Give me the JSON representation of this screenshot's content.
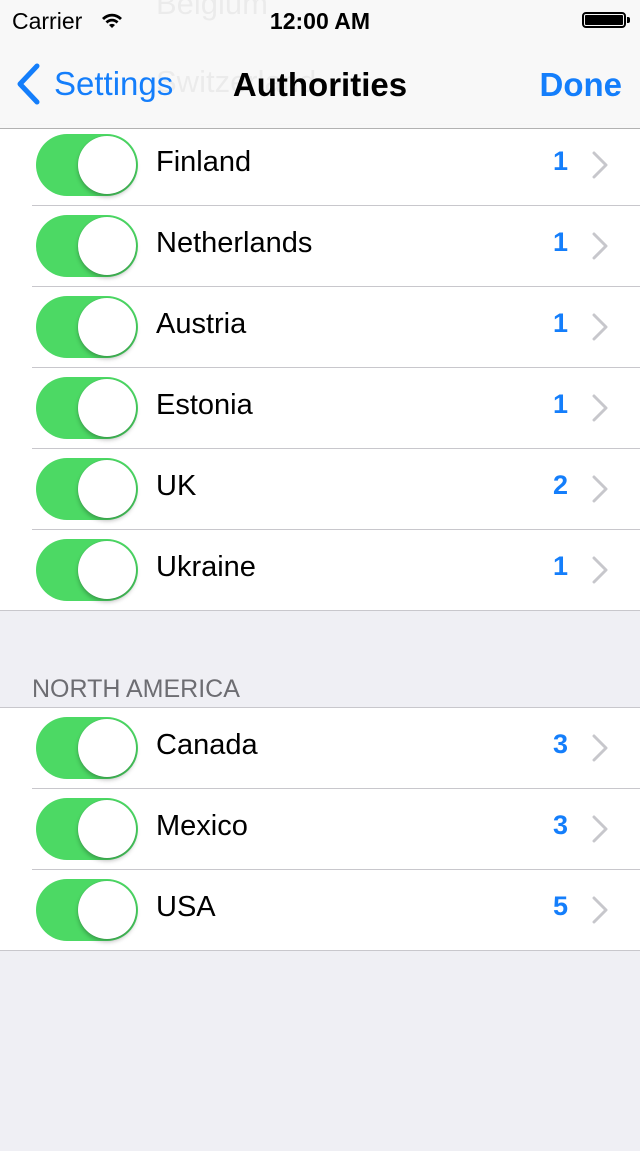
{
  "status_bar": {
    "carrier": "Carrier",
    "time": "12:00 AM",
    "wifi_icon": "wifi-icon",
    "battery_icon": "battery-icon"
  },
  "nav": {
    "back_label": "Settings",
    "back_icon": "chevron-left-icon",
    "title": "Authorities",
    "done_label": "Done",
    "ghost_rows": [
      "Belgium",
      "Switzerland"
    ]
  },
  "colors": {
    "accent": "#147efb",
    "toggle_on": "#4cd964",
    "chevron": "#c7c7cc",
    "section_header": "#6d6d72"
  },
  "sections": [
    {
      "header": "",
      "rows": [
        {
          "name": "Finland",
          "count": "1",
          "enabled": true
        },
        {
          "name": "Netherlands",
          "count": "1",
          "enabled": true
        },
        {
          "name": "Austria",
          "count": "1",
          "enabled": true
        },
        {
          "name": "Estonia",
          "count": "1",
          "enabled": true
        },
        {
          "name": "UK",
          "count": "2",
          "enabled": true
        },
        {
          "name": "Ukraine",
          "count": "1",
          "enabled": true
        }
      ]
    },
    {
      "header": "NORTH AMERICA",
      "rows": [
        {
          "name": "Canada",
          "count": "3",
          "enabled": true
        },
        {
          "name": "Mexico",
          "count": "3",
          "enabled": true
        },
        {
          "name": "USA",
          "count": "5",
          "enabled": true
        }
      ]
    }
  ]
}
